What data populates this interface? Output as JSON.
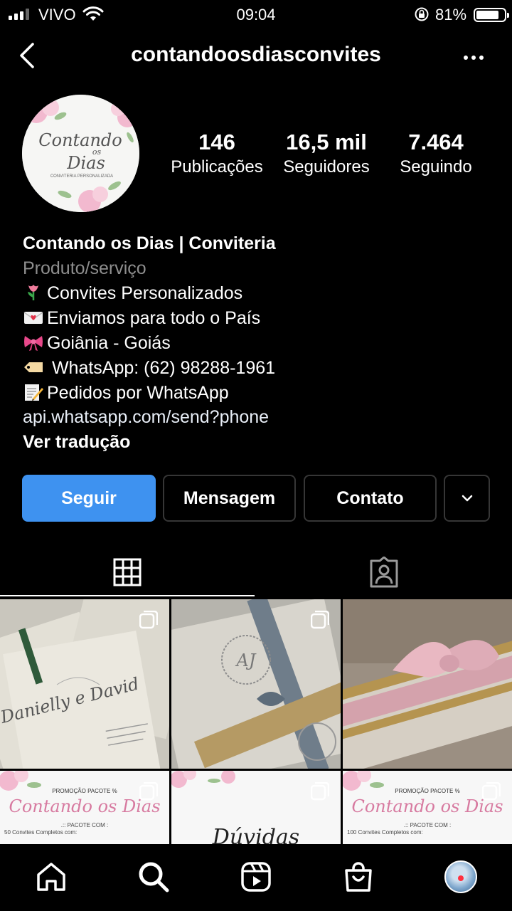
{
  "status": {
    "carrier": "VIVO",
    "time": "09:04",
    "battery": "81%",
    "battery_level": 0.81
  },
  "header": {
    "username": "contandoosdiasconvites",
    "back_icon": "chevron-left-icon",
    "more_icon": "more-horizontal-icon"
  },
  "avatar": {
    "logo_line1": "Contando",
    "logo_line2": "os",
    "logo_line3": "Dias",
    "logo_tagline": "CONVITERIA PERSONALIZADA"
  },
  "stats": [
    {
      "count": "146",
      "label": "Publicações"
    },
    {
      "count": "16,5 mil",
      "label": "Seguidores"
    },
    {
      "count": "7.464",
      "label": "Seguindo"
    }
  ],
  "bio": {
    "name": "Contando os Dias | Conviteria",
    "category": "Produto/serviço",
    "lines": [
      {
        "emoji": "tulip",
        "text": "Convites Personalizados"
      },
      {
        "emoji": "love-letter",
        "text": "Enviamos para todo o País"
      },
      {
        "emoji": "ribbon",
        "text": "Goiânia - Goiás"
      },
      {
        "emoji": "label-tag",
        "text": " WhatsApp: (62) 98288-1961"
      },
      {
        "emoji": "memo",
        "text": "Pedidos por WhatsApp"
      }
    ],
    "link": "api.whatsapp.com/send?phone",
    "translate": "Ver tradução"
  },
  "buttons": {
    "follow": "Seguir",
    "message": "Mensagem",
    "contact": "Contato"
  },
  "colors": {
    "accent": "#3e92f0",
    "muted": "#8e8e8e",
    "notification": "#ff3040"
  },
  "grid": {
    "tiles": [
      {
        "kind": "invite-photo",
        "multiple": true,
        "names": "Danielly e David"
      },
      {
        "kind": "invite-photo",
        "multiple": true,
        "monogram": "AJ"
      },
      {
        "kind": "ribbon-photo",
        "multiple": false
      },
      {
        "kind": "promo",
        "multiple": true,
        "title": "PROMOÇÃO PACOTE %",
        "brand": "Contando os Dias",
        "subtitle": ".:: PACOTE COM :",
        "detail": "50 Convites Completos com:"
      },
      {
        "kind": "duvidas",
        "multiple": true,
        "text": "Dúvidas"
      },
      {
        "kind": "promo",
        "multiple": true,
        "title": "PROMOÇÃO PACOTE %",
        "brand": "Contando os Dias",
        "subtitle": ".:: PACOTE COM :",
        "detail": "100 Convites Completos com:"
      }
    ]
  },
  "tabbar": {
    "items": [
      "home-icon",
      "search-icon",
      "reels-icon",
      "shop-icon",
      "profile-avatar"
    ]
  }
}
